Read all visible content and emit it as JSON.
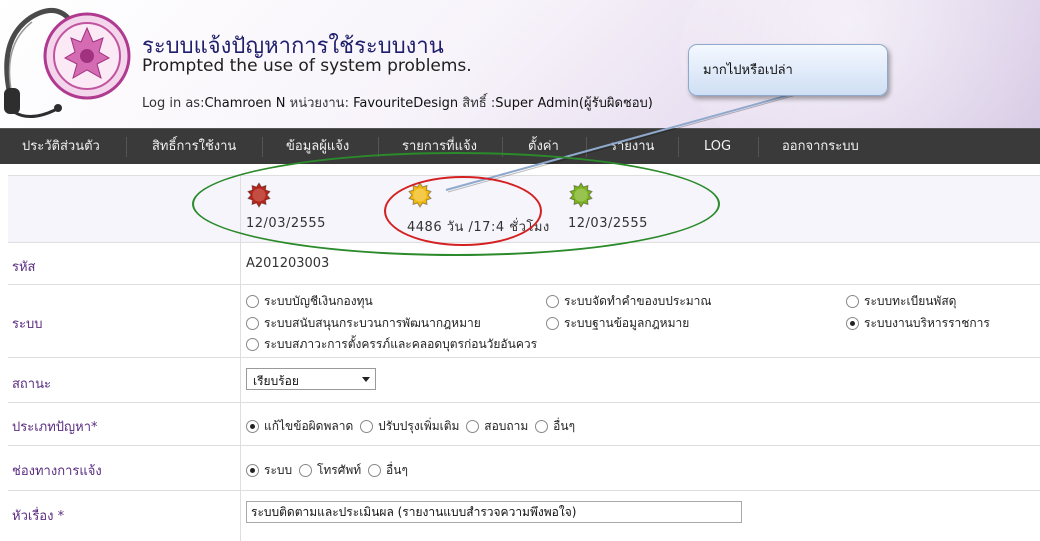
{
  "header": {
    "title_th": "ระบบแจ้งปัญหาการใช้ระบบงาน",
    "title_en": "Prompted the use of system problems.",
    "login_prefix": "Log in as:",
    "login_user": "Chamroen N",
    "dept_label": " หน่วยงาน: ",
    "dept_value": "FavouriteDesign",
    "role_label": " สิทธิ์ :",
    "role_value": "Super Admin(ผู้รับผิดชอบ)"
  },
  "callout": {
    "text": "มากไปหรือเปล่า"
  },
  "nav": {
    "items": [
      "ประวัติส่วนตัว",
      "สิทธิ์การใช้งาน",
      "ข้อมูลผู้แจ้ง",
      "รายการที่แจ้ง",
      "ตั้งค่า",
      "รายงาน",
      "LOG",
      "ออกจากระบบ"
    ]
  },
  "status": {
    "items": [
      {
        "color": "#b8261b",
        "text": "12/03/2555"
      },
      {
        "color": "#f2b90f",
        "text": "4486 วัน /17:4 ชั่วโมง"
      },
      {
        "color": "#7cb31f",
        "text": "12/03/2555"
      }
    ]
  },
  "form": {
    "code": {
      "label": "รหัส",
      "value": "A201203003"
    },
    "system": {
      "label": "ระบบ",
      "options": [
        {
          "text": "ระบบบัญชีเงินกองทุน",
          "selected": false
        },
        {
          "text": "ระบบจัดทำคำของบประมาณ",
          "selected": false
        },
        {
          "text": "ระบบทะเบียนพัสดุ",
          "selected": false
        },
        {
          "text": "ระบบสนับสนุนกระบวนการพัฒนากฎหมาย",
          "selected": false
        },
        {
          "text": "ระบบฐานข้อมูลกฎหมาย",
          "selected": false
        },
        {
          "text": "ระบบงานบริหารราชการ",
          "selected": true
        },
        {
          "text": "ระบบสภาวะการตั้งครรภ์และคลอดบุตรก่อนวัยอันควร",
          "selected": false
        }
      ]
    },
    "status": {
      "label": "สถานะ",
      "value": "เรียบร้อย"
    },
    "problem_type": {
      "label": "ประเภทปัญหา*",
      "options": [
        {
          "text": "แก้ไขข้อผิดพลาด",
          "selected": true
        },
        {
          "text": "ปรับปรุงเพิ่มเติม",
          "selected": false
        },
        {
          "text": "สอบถาม",
          "selected": false
        },
        {
          "text": "อื่นๆ",
          "selected": false
        }
      ]
    },
    "channel": {
      "label": "ช่องทางการแจ้ง",
      "options": [
        {
          "text": "ระบบ",
          "selected": true
        },
        {
          "text": "โทรศัพท์",
          "selected": false
        },
        {
          "text": "อื่นๆ",
          "selected": false
        }
      ]
    },
    "subject": {
      "label": "หัวเรื่อง *",
      "value": "ระบบติดตามและประเมินผล (รายงานแบบสำรวจความพึงพอใจ)"
    }
  }
}
